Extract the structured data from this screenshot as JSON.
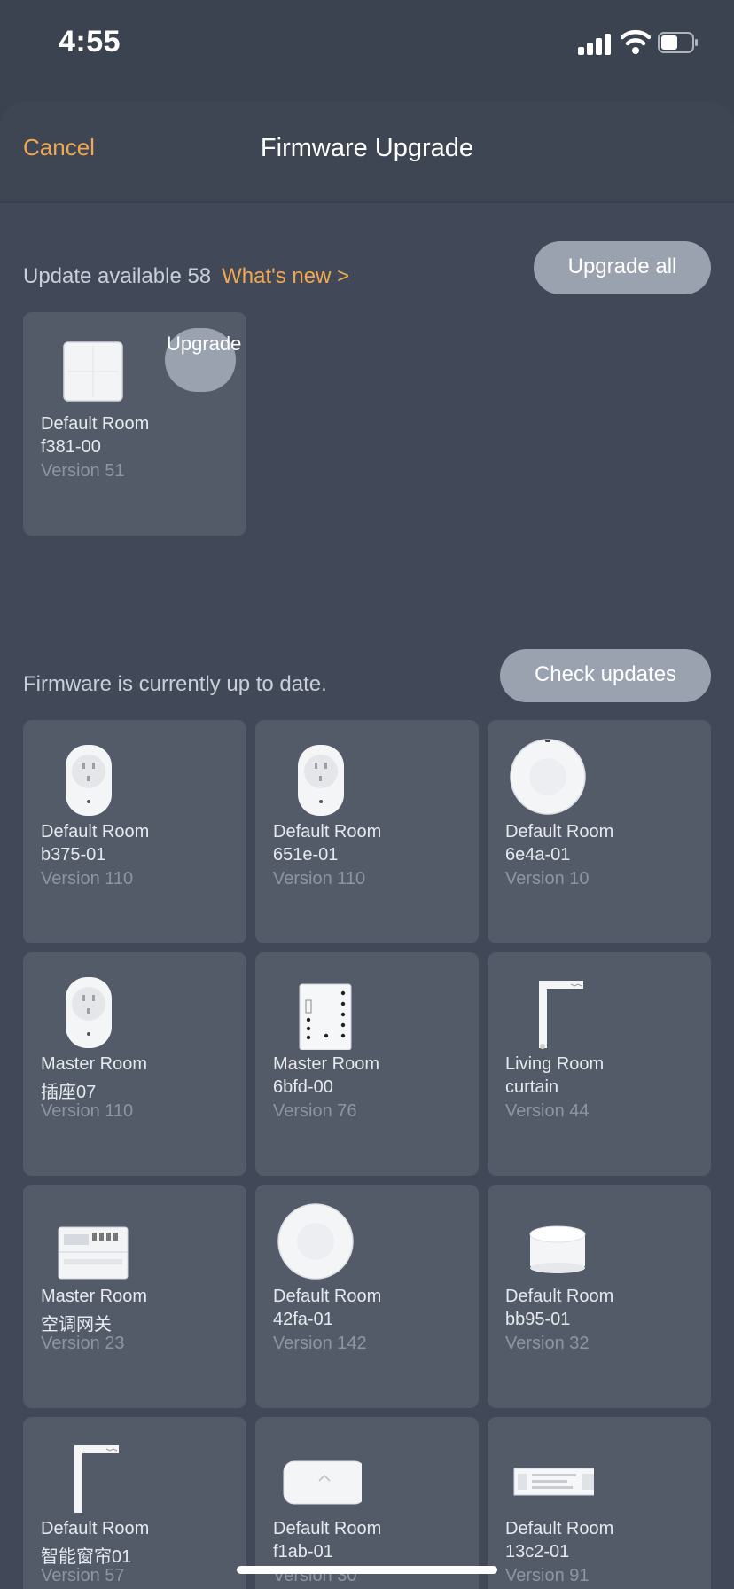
{
  "status_bar": {
    "time": "4:55"
  },
  "nav": {
    "cancel_label": "Cancel",
    "title": "Firmware Upgrade"
  },
  "available": {
    "label": "Update available 58",
    "whats_new_label": "What's new >",
    "upgrade_all_label": "Upgrade all",
    "devices": [
      {
        "room": "Default Room",
        "name": "f381-00",
        "version": "Version 51",
        "icon": "wall-switch-icon",
        "upgrade_label": "Upgrade"
      }
    ]
  },
  "uptodate": {
    "label": "Firmware is currently up to date.",
    "check_updates_label": "Check updates",
    "devices": [
      {
        "room": "Default Room",
        "name": "b375-01",
        "version": "Version 110",
        "icon": "smart-plug-icon"
      },
      {
        "room": "Default Room",
        "name": "651e-01",
        "version": "Version 110",
        "icon": "smart-plug-icon"
      },
      {
        "room": "Default Room",
        "name": "6e4a-01",
        "version": "Version 10",
        "icon": "round-sensor-icon"
      },
      {
        "room": "Master Room",
        "name": "插座07",
        "version": "Version 110",
        "icon": "smart-plug-icon"
      },
      {
        "room": "Master Room",
        "name": "6bfd-00",
        "version": "Version 76",
        "icon": "relay-module-icon"
      },
      {
        "room": "Living Room",
        "name": "curtain",
        "version": "Version 44",
        "icon": "curtain-motor-icon"
      },
      {
        "room": "Master Room",
        "name": "空调网关",
        "version": "Version 23",
        "icon": "din-rail-gateway-icon"
      },
      {
        "room": "Default Room",
        "name": "42fa-01",
        "version": "Version 142",
        "icon": "round-sensor-icon"
      },
      {
        "room": "Default Room",
        "name": "bb95-01",
        "version": "Version 32",
        "icon": "hub-cylinder-icon"
      },
      {
        "room": "Default Room",
        "name": "智能窗帘01",
        "version": "Version 57",
        "icon": "curtain-motor-icon"
      },
      {
        "room": "Default Room",
        "name": "f1ab-01",
        "version": "Version 30",
        "icon": "gateway-box-icon"
      },
      {
        "room": "Default Room",
        "name": "13c2-01",
        "version": "Version 91",
        "icon": "led-driver-icon"
      }
    ]
  }
}
